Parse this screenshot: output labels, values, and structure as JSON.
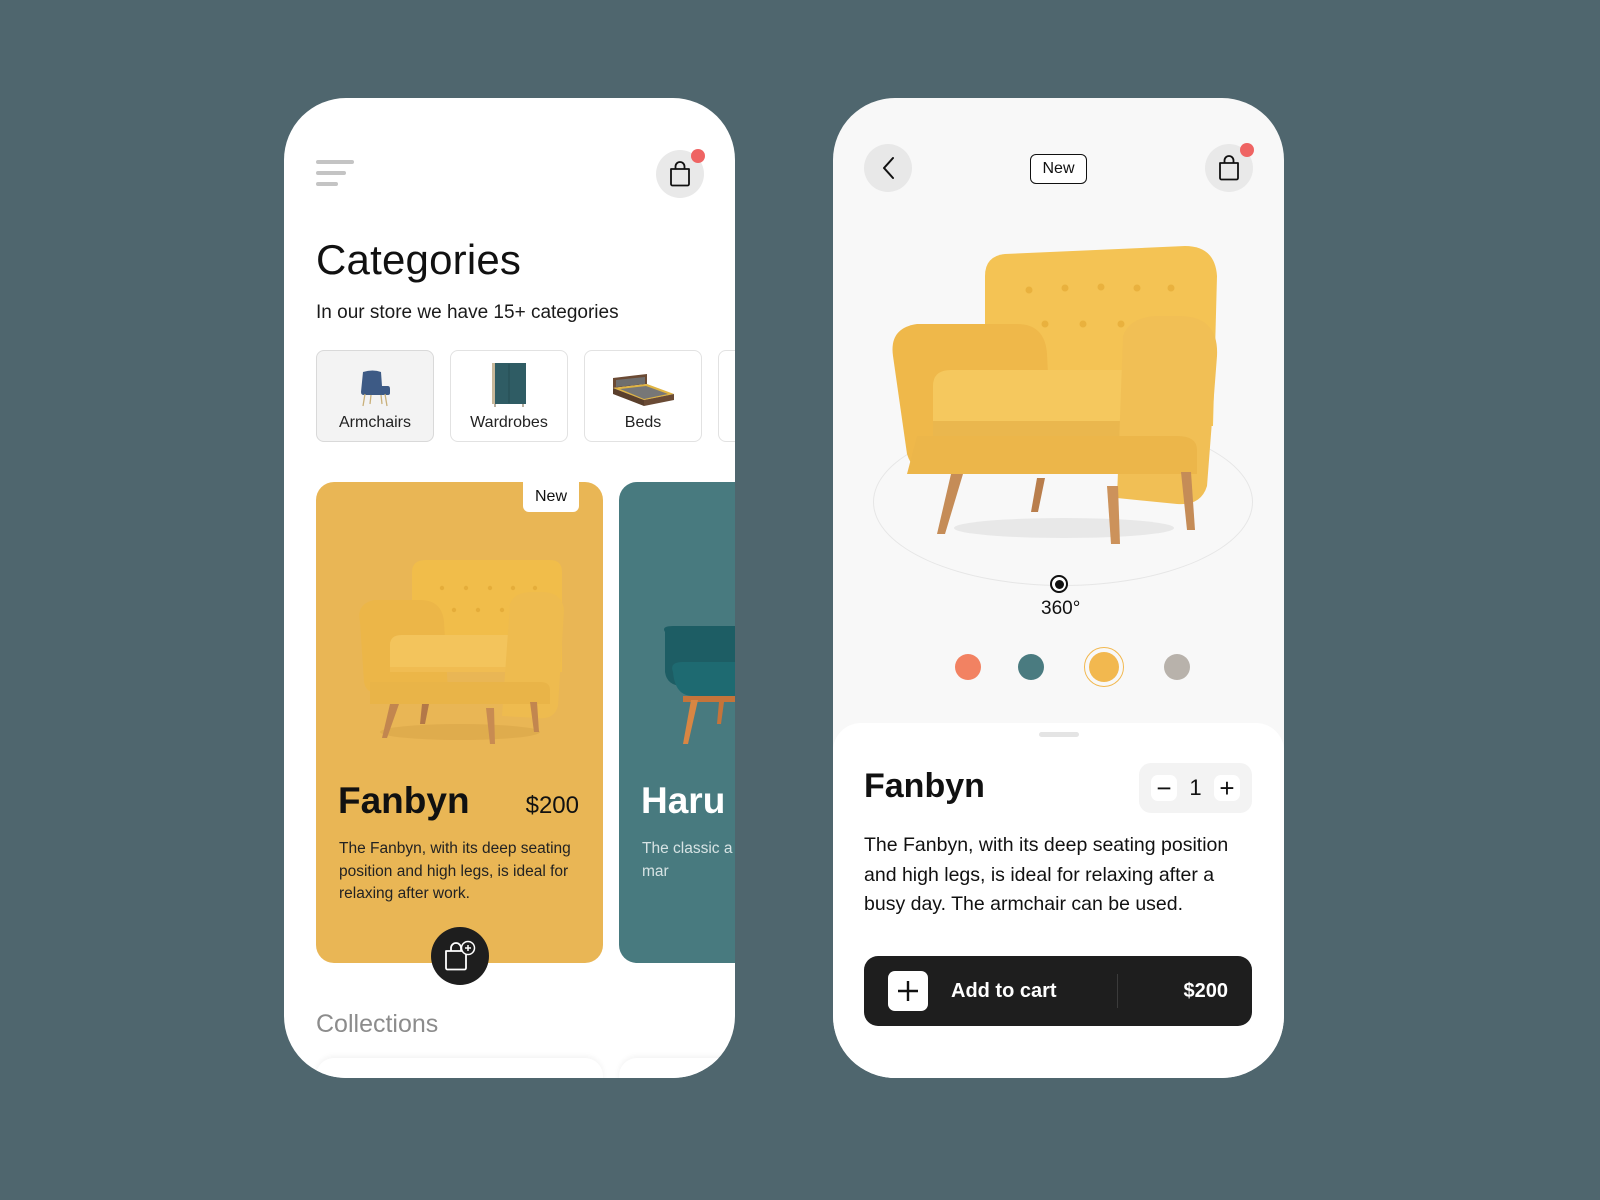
{
  "colors": {
    "background": "#4f666e",
    "accent_yellow": "#e9b655",
    "accent_teal": "#487a7f",
    "notification": "#ef6463",
    "dark": "#1e1e1e"
  },
  "list_screen": {
    "menu_icon": "hamburger-menu-icon",
    "cart_icon": "shopping-bag-icon",
    "cart_has_notification": true,
    "title": "Categories",
    "subtitle": "In our store we have 15+ categories",
    "categories": [
      {
        "label": "Armchairs",
        "icon": "armchair-image",
        "selected": true
      },
      {
        "label": "Wardrobes",
        "icon": "wardrobe-image",
        "selected": false
      },
      {
        "label": "Beds",
        "icon": "bed-image",
        "selected": false
      }
    ],
    "products": [
      {
        "name": "Fanbyn",
        "price": "$200",
        "badge": "New",
        "description": "The Fanbyn, with its deep seating position and high legs, is ideal for relaxing after work.",
        "color": "#e9b655"
      },
      {
        "name": "Haru",
        "price": "",
        "badge": "",
        "description": "The classic a decorate the room for mar",
        "color": "#487a7f"
      }
    ],
    "add_to_cart_icon": "bag-plus-icon",
    "collections_title": "Collections"
  },
  "detail_screen": {
    "back_icon": "chevron-left-icon",
    "badge": "New",
    "cart_icon": "shopping-bag-icon",
    "cart_has_notification": true,
    "rotation_label": "360°",
    "color_options": [
      {
        "name": "coral",
        "hex": "#f28262",
        "selected": false
      },
      {
        "name": "teal",
        "hex": "#4a7b80",
        "selected": false
      },
      {
        "name": "yellow",
        "hex": "#f2b84f",
        "selected": true
      },
      {
        "name": "grey",
        "hex": "#b8b2ab",
        "selected": false
      }
    ],
    "product_name": "Fanbyn",
    "quantity": "1",
    "quantity_minus": "−",
    "quantity_plus": "+",
    "description": "The Fanbyn, with its deep seating position and high legs, is ideal for relaxing after a busy day. The armchair can be used.",
    "add_to_cart_label": "Add to cart",
    "price": "$200"
  }
}
